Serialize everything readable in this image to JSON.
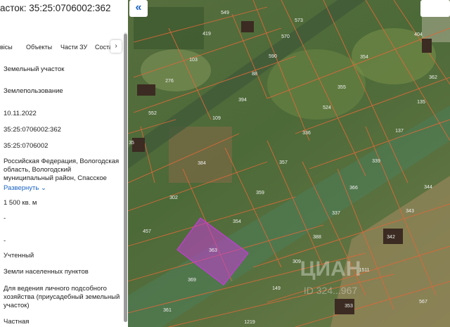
{
  "panel": {
    "title": "асток: 35:25:0706002:362",
    "tabs": [
      "вісы",
      "Объекты",
      "Части ЗУ",
      "Соста"
    ],
    "tab_next": "›",
    "rows": [
      "Земельный участок",
      "Землепользование",
      "10.11.2022",
      "35:25:0706002:362",
      "35:25:0706002",
      "Российская Федерация, Вологодская область, Вологодский муниципальный район, Спасское",
      "Развернуть",
      "1 500 кв. м",
      "-",
      "-",
      "Учтенный",
      "Земли населенных пунктов",
      "Для ведения личного подсобного хозяйства (приусадебный земельный участок)",
      "Частная"
    ],
    "expand_icon": "chevron-down-icon"
  },
  "map_controls": {
    "collapse_label": "«",
    "collapse_icon": "double-chevron-left-icon"
  },
  "map": {
    "parcels": [
      "549",
      "573",
      "419",
      "570",
      "404",
      "103",
      "590",
      "354",
      "276",
      "88",
      "355",
      "362",
      "394",
      "524",
      "135",
      "552",
      "109",
      "336",
      "137",
      "384",
      "357",
      "339",
      "302",
      "359",
      "366",
      "344",
      "354",
      "337",
      "343",
      "457",
      "388",
      "342",
      "363",
      "309",
      "1511",
      "369",
      "149",
      "353",
      "567",
      "361",
      "1219",
      "35"
    ],
    "highlight_color": "#c43cd6",
    "boundary_color": "#d9693a",
    "watermark": "ЦИАН",
    "watermark_id": "ID 324...967"
  }
}
